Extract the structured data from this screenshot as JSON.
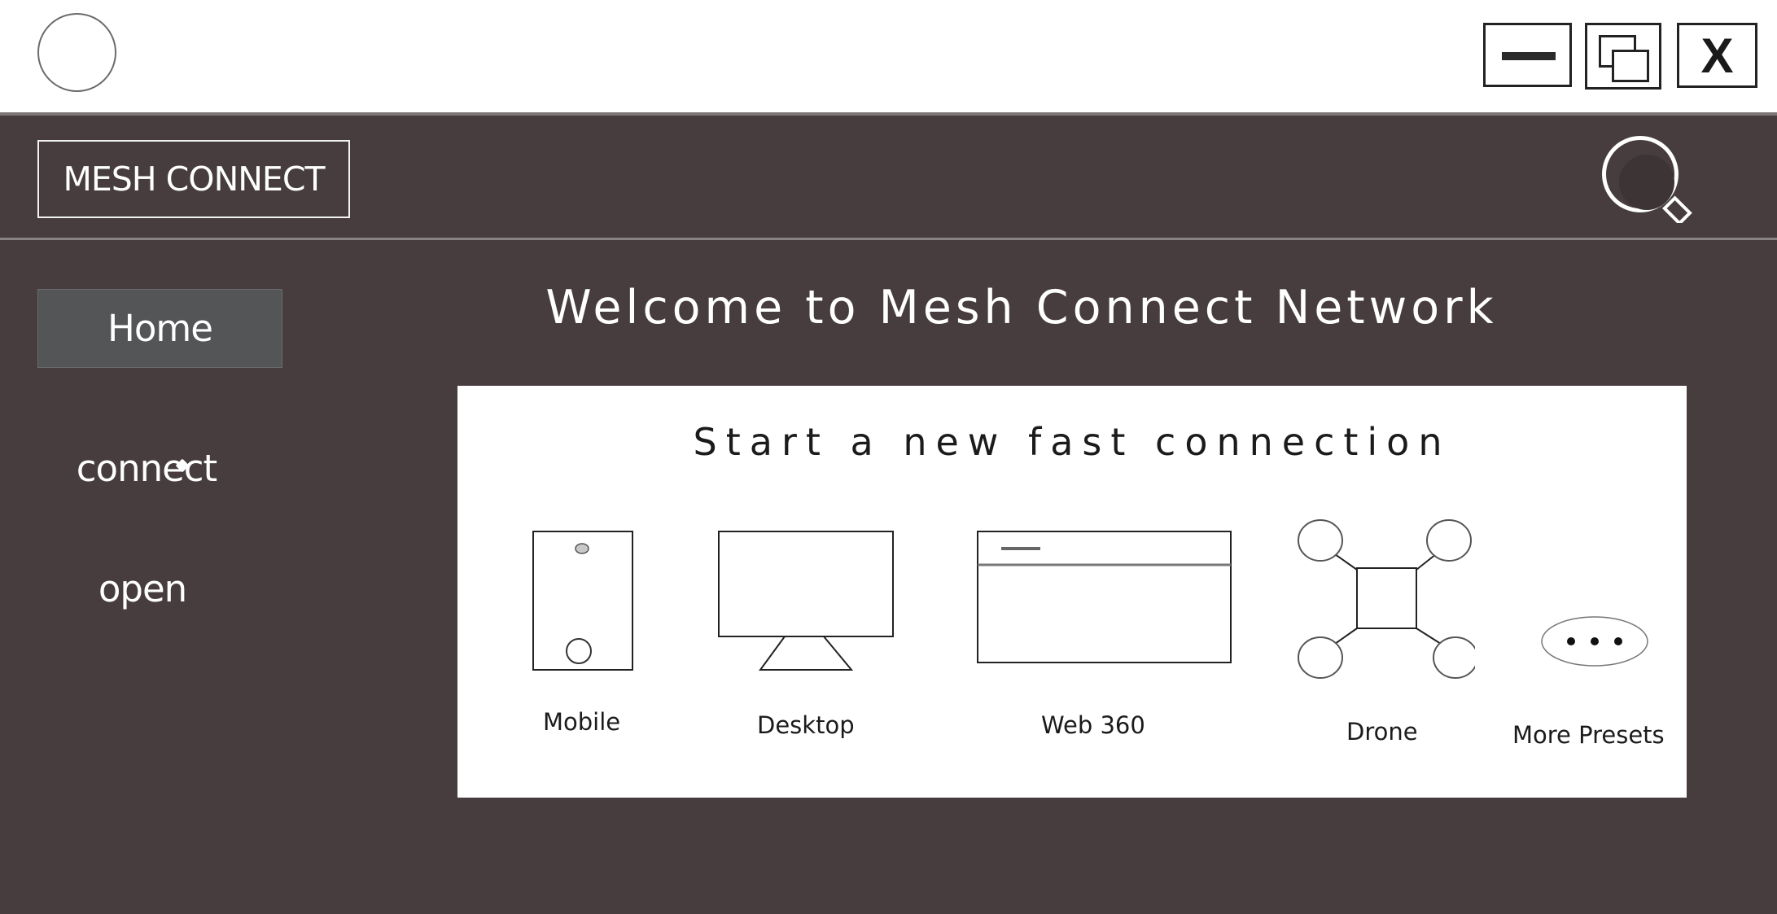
{
  "app": {
    "brand": "MESH CONNECT"
  },
  "window_controls": {
    "close_label": "X"
  },
  "sidebar": {
    "items": [
      {
        "label": "Home",
        "active": true
      },
      {
        "label": "connect",
        "active": false
      },
      {
        "label": "open",
        "active": false
      }
    ]
  },
  "main": {
    "welcome_title": "Welcome to Mesh Connect Network",
    "panel": {
      "title": "Start a new fast connection",
      "presets": [
        {
          "label": "Mobile",
          "icon": "mobile-icon"
        },
        {
          "label": "Desktop",
          "icon": "desktop-icon"
        },
        {
          "label": "Web 360",
          "icon": "browser-window-icon"
        },
        {
          "label": "Drone",
          "icon": "drone-icon"
        },
        {
          "label": "More Presets",
          "icon": "more-dots-icon"
        }
      ]
    }
  },
  "colors": {
    "background": "#473d3e",
    "titlebar": "#ffffff",
    "active_nav": "#545557",
    "panel": "#ffffff"
  }
}
